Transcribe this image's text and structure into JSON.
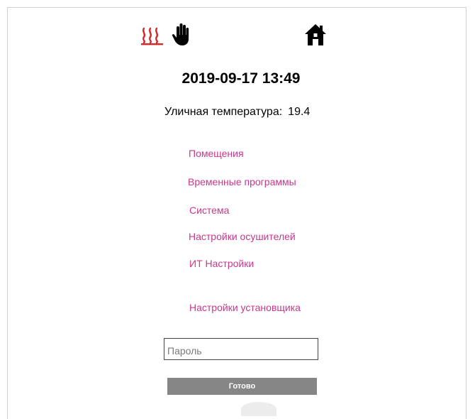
{
  "header": {
    "icons": [
      "heating-icon",
      "manual-mode-hand-icon",
      "home-icon"
    ],
    "heating_color": "#d42828",
    "datetime": "2019-09-17 13:49"
  },
  "outdoor": {
    "label": "Уличная температура:",
    "value": "19.4"
  },
  "menu": {
    "link_color": "#c8388a",
    "items": [
      {
        "label": "Помещения"
      },
      {
        "label": "Временные программы"
      },
      {
        "label": "Система"
      },
      {
        "label": "Настройки осушителей"
      },
      {
        "label": "ИТ Настройки"
      },
      {
        "label": "Настройки установщика"
      }
    ]
  },
  "login": {
    "password_placeholder": "Пароль",
    "password_value": "",
    "submit_label": "Готово"
  }
}
